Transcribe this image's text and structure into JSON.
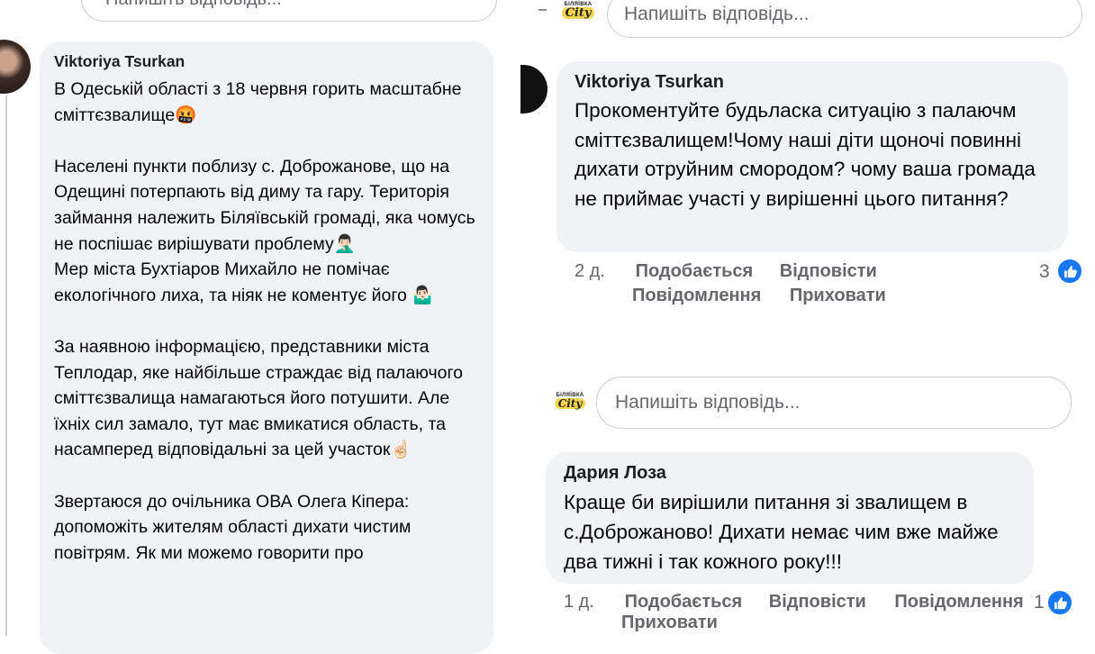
{
  "left": {
    "reply_placeholder": "Напишіть відповідь...",
    "comment": {
      "author": "Viktoriya Tsurkan",
      "text": "В Одеській області з 18 червня горить масштабне сміттєзвалище🤬\n\nНаселені пункти поблизу с. Доброжанове, що на Одещині потерпають від диму та гару. Територія займання належить Біляївській громаді, яка чомусь не поспішає вирішувати проблему🤦🏻‍♂️\nМер міста Бухтіаров Михайло не помічає екологічного лиха, та ніяк не коментує його 🤷🏻‍♂️\n\nЗа наявною інформацією, представники міста Теплодар, яке найбільше страждає від палаючого сміттєзвалища намагаються його потушити. Але їхніх сил замало, тут має вмикатися область, та насамперед відповідальні за цей участок☝🏻\n\nЗвертаюся до очільника ОВА Олега Кіпера: допоможіть жителям області дихати чистим повітрям. Як ми можемо говорити про"
    }
  },
  "right": {
    "logo": {
      "line1": "БІЛЯЇВКА",
      "line2": "City"
    },
    "reply_placeholder_top": "Напишіть відповідь...",
    "comment1": {
      "author": "Viktoriya Tsurkan",
      "text": "Прокоментуйте будьласка ситуацію з палаючм сміттєзвалищем!Чому наші діти щоночі повинні дихати отруйним смородом? чому ваша громада не приймає участі у вирішенні цього питання?",
      "time": "2 д.",
      "like_label": "Подобається",
      "reply_label": "Відповісти",
      "report_label": "Повідомлення",
      "hide_label": "Приховати",
      "reaction_count": "3"
    },
    "reply_placeholder_middle": "Напишіть відповідь...",
    "comment2": {
      "author": "Дария Лоза",
      "text": "Краще би вирішили питання зі звалищем в с.Доброжаново! Дихати немає чим вже майже два тижні і так кожного року!!!",
      "time": "1 д.",
      "like_label": "Подобається",
      "reply_label": "Відповісти",
      "report_label": "Повідомлення",
      "hide_label": "Приховати",
      "reaction_count": "1"
    }
  },
  "colors": {
    "bubble": "#f0f2f5",
    "like_blue": "#1877f2",
    "muted": "#65676b"
  },
  "icons": [
    "avatar",
    "like-thumb-icon",
    "biliaivka-city-logo"
  ]
}
